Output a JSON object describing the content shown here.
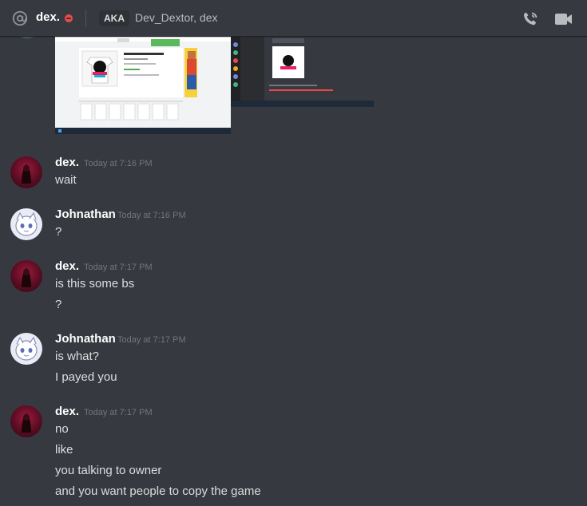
{
  "header": {
    "dm_name": "dex.",
    "status": "do-not-disturb",
    "aka_label": "AKA",
    "aka_names": "Dev_Dextor, dex",
    "icons": [
      "at-icon",
      "voice-call-icon",
      "video-call-icon"
    ]
  },
  "colors": {
    "background": "#36393f",
    "dnd_red": "#f04747",
    "author": "#ffffff",
    "timestamp": "#72767d",
    "message_text": "#dcddde"
  },
  "messages": [
    {
      "author": "dex.",
      "timestamp": "Today at 7:16 PM",
      "lines": [
        "wait"
      ]
    },
    {
      "author": "Johnathan",
      "timestamp": "Today at 7:16 PM",
      "lines": [
        "?"
      ]
    },
    {
      "author": "dex.",
      "timestamp": "Today at 7:17 PM",
      "lines": [
        "is this some bs",
        "?"
      ]
    },
    {
      "author": "Johnathan",
      "timestamp": "Today at 7:17 PM",
      "lines": [
        "is what?",
        "I payed you"
      ]
    },
    {
      "author": "dex.",
      "timestamp": "Today at 7:17 PM",
      "lines": [
        "no",
        "like",
        "you talking to owner",
        "and you want people to copy the game"
      ]
    }
  ]
}
